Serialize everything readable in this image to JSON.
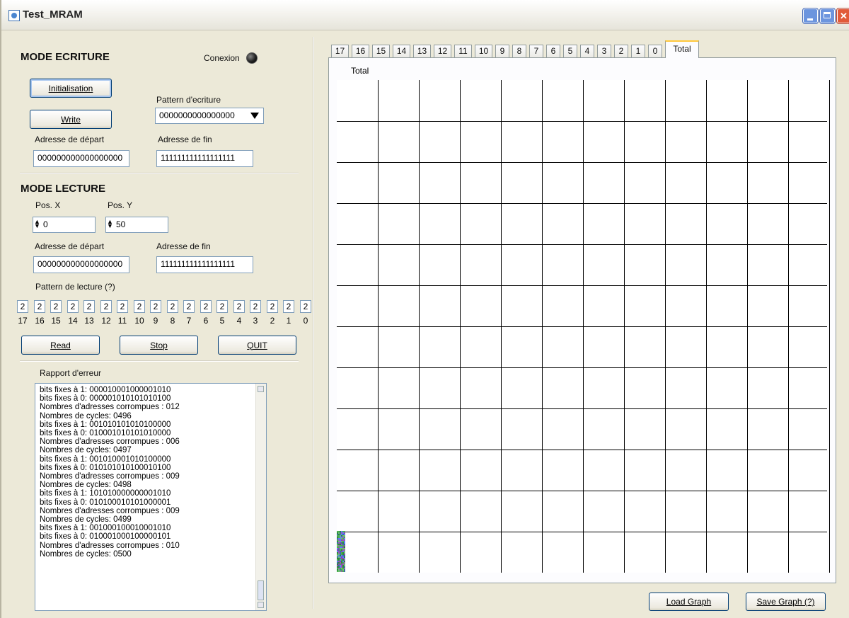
{
  "window": {
    "title": "Test_MRAM"
  },
  "mode_ecriture": {
    "heading": "MODE ECRITURE",
    "conexion_label": "Conexion",
    "init_button": "Initialisation",
    "write_button": "Write",
    "pattern_label": "Pattern d'ecriture",
    "pattern_value": "0000000000000000",
    "start_label": "Adresse de départ",
    "start_value": "000000000000000000",
    "end_label": "Adresse de fin",
    "end_value": "111111111111111111"
  },
  "mode_lecture": {
    "heading": "MODE LECTURE",
    "posx_label": "Pos. X",
    "posx_value": "0",
    "posy_label": "Pos. Y",
    "posy_value": "50",
    "start_label": "Adresse de départ",
    "start_value": "000000000000000000",
    "end_label": "Adresse de fin",
    "end_value": "111111111111111111",
    "pattern_label": "Pattern de lecture  (?)",
    "bits": [
      "2",
      "2",
      "2",
      "2",
      "2",
      "2",
      "2",
      "2",
      "2",
      "2",
      "2",
      "2",
      "2",
      "2",
      "2",
      "2",
      "2",
      "2"
    ],
    "bit_labels": [
      "17",
      "16",
      "15",
      "14",
      "13",
      "12",
      "11",
      "10",
      "9",
      "8",
      "7",
      "6",
      "5",
      "4",
      "3",
      "2",
      "1",
      "0"
    ]
  },
  "actions": {
    "read": "Read",
    "stop": "Stop",
    "quit": "QUIT"
  },
  "error_report": {
    "label": "Rapport d'erreur",
    "lines": [
      "bits fixes à 1: 000010001000001010",
      "bits fixes à 0: 000001010101010100",
      "Nombres d'adresses corrompues : 012",
      "Nombres de cycles: 0496",
      "bits fixes à 1: 001010101010100000",
      "bits fixes à 0: 010001010101010000",
      "Nombres d'adresses corrompues : 006",
      "Nombres de cycles: 0497",
      "bits fixes à 1: 001010001010100000",
      "bits fixes à 0: 010101010100010100",
      "Nombres d'adresses corrompues : 009",
      "Nombres de cycles: 0498",
      "bits fixes à 1: 101010000000001010",
      "bits fixes à 0: 010100010101000001",
      "Nombres d'adresses corrompues : 009",
      "Nombres de cycles: 0499",
      "bits fixes à 1: 001000100010001010",
      "bits fixes à 0: 010001000100000101",
      "Nombres d'adresses corrompues : 010",
      "Nombres de cycles: 0500"
    ]
  },
  "tabs": {
    "items": [
      "17",
      "16",
      "15",
      "14",
      "13",
      "12",
      "11",
      "10",
      "9",
      "8",
      "7",
      "6",
      "5",
      "4",
      "3",
      "2",
      "1",
      "0",
      "Total"
    ],
    "active": "Total"
  },
  "graph": {
    "title": "Total",
    "columns": 12,
    "rows": 12
  },
  "graph_buttons": {
    "load": "Load Graph",
    "save": "Save Graph (?)"
  }
}
